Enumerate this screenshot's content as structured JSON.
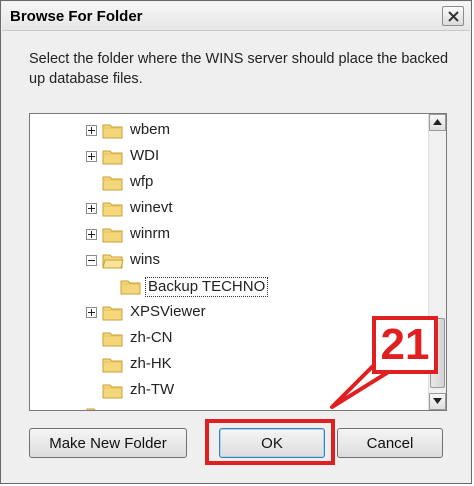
{
  "window": {
    "title": "Browse For Folder"
  },
  "instructions": "Select the folder where the WINS server should place the backed up database files.",
  "tree": {
    "items": [
      {
        "label": "wbem",
        "expandable": true,
        "expanded": false
      },
      {
        "label": "WDI",
        "expandable": true,
        "expanded": false
      },
      {
        "label": "wfp",
        "expandable": false
      },
      {
        "label": "winevt",
        "expandable": true,
        "expanded": false
      },
      {
        "label": "winrm",
        "expandable": true,
        "expanded": false
      },
      {
        "label": "wins",
        "expandable": true,
        "expanded": true
      },
      {
        "label": "Backup TECHNO",
        "expandable": false,
        "selected": true
      },
      {
        "label": "XPSViewer",
        "expandable": true,
        "expanded": false
      },
      {
        "label": "zh-CN",
        "expandable": false
      },
      {
        "label": "zh-HK",
        "expandable": false
      },
      {
        "label": "zh-TW",
        "expandable": false
      }
    ]
  },
  "buttons": {
    "make_new_folder": "Make New Folder",
    "ok": "OK",
    "cancel": "Cancel"
  },
  "annotation": {
    "step_number": "21",
    "color": "#e02020"
  },
  "icons": {
    "close": "close-icon",
    "folder": "folder-icon",
    "expand": "plus-icon",
    "collapse": "minus-icon",
    "scroll_up": "arrow-up-icon",
    "scroll_down": "arrow-down-icon"
  }
}
